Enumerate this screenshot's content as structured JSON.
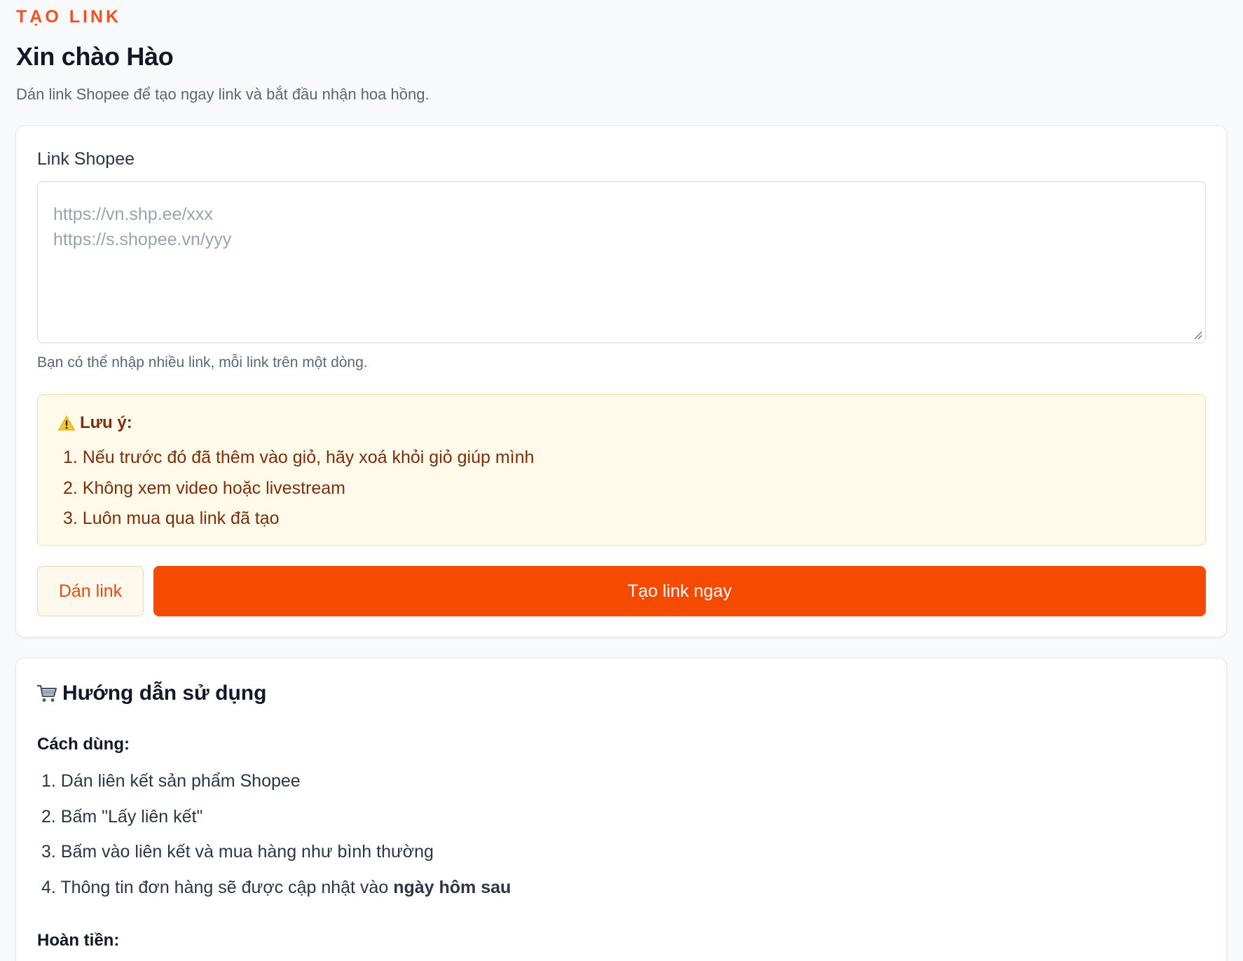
{
  "header": {
    "eyebrow": "TẠO LINK",
    "greeting": "Xin chào Hào",
    "subtitle": "Dán link Shopee để tạo ngay link và bắt đầu nhận hoa hồng."
  },
  "form": {
    "field_label": "Link Shopee",
    "placeholder": "https://vn.shp.ee/xxx\nhttps://s.shopee.vn/yyy",
    "value": "",
    "helper": "Bạn có thể nhập nhiều link, mỗi link trên một dòng.",
    "note": {
      "icon": "warning-icon",
      "title": "Lưu ý:",
      "items": [
        "1. Nếu trước đó đã thêm vào giỏ, hãy xoá khỏi giỏ giúp mình",
        "2. Không xem video hoặc livestream",
        "3. Luôn mua qua link đã tạo"
      ]
    },
    "paste_button": "Dán link",
    "create_button": "Tạo link ngay"
  },
  "guide": {
    "icon": "cart-icon",
    "title": "Hướng dẫn sử dụng",
    "usage_heading": "Cách dùng:",
    "usage_steps": [
      "1. Dán liên kết sản phẩm Shopee",
      "2. Bấm \"Lấy liên kết\"",
      "3. Bấm vào liên kết và mua hàng như bình thường"
    ],
    "step4_prefix": "4. Thông tin đơn hàng sẽ được cập nhật vào ",
    "step4_bold": "ngày hôm sau",
    "refund_heading": "Hoàn tiền:"
  },
  "colors": {
    "accent": "#f64a00",
    "note_bg": "#fffaea",
    "note_text": "#7a2e0b"
  }
}
